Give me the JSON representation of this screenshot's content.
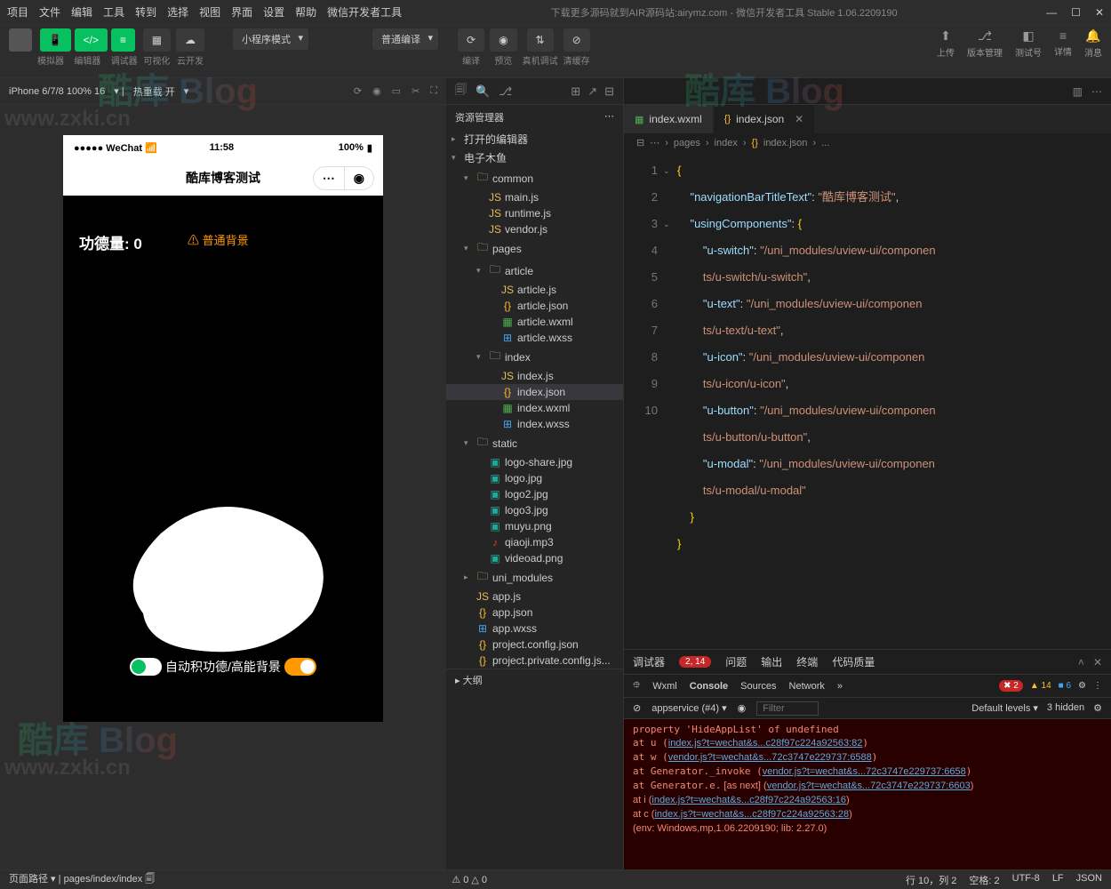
{
  "menubar": [
    "项目",
    "文件",
    "编辑",
    "工具",
    "转到",
    "选择",
    "视图",
    "界面",
    "设置",
    "帮助",
    "微信开发者工具"
  ],
  "window_title_suffix": "下载更多源码就到AIR源码站:airymz.com - 微信开发者工具 Stable 1.06.2209190",
  "toolbar": {
    "simulator": "模拟器",
    "editor": "编辑器",
    "debugger": "调试器",
    "visualize": "可视化",
    "cloud": "云开发",
    "mode_select": "小程序模式",
    "compile_select": "普通编译",
    "compile": "编译",
    "preview": "预览",
    "remote": "真机调试",
    "clearcache": "清缓存",
    "upload": "上传",
    "version": "版本管理",
    "testacct": "测试号",
    "details": "详情",
    "messages": "消息"
  },
  "simheader": {
    "device": "iPhone 6/7/8 100% 16",
    "hotreload": "热重载 开"
  },
  "phone": {
    "carrier": "WeChat",
    "time": "11:58",
    "battery": "100%",
    "nav_title": "酷库博客测试",
    "merit_label": "功德量:",
    "merit_value": "0",
    "bg_btn": "⚠ 普通背景",
    "switch_label": "自动积功德/高能背景"
  },
  "explorer": {
    "title": "资源管理器",
    "sections": {
      "open_editors": "打开的编辑器",
      "project": "电子木鱼",
      "outline": "大纲"
    },
    "tree": {
      "common": {
        "name": "common",
        "files": [
          "main.js",
          "runtime.js",
          "vendor.js"
        ]
      },
      "pages": {
        "name": "pages",
        "article": {
          "name": "article",
          "files": [
            "article.js",
            "article.json",
            "article.wxml",
            "article.wxss"
          ]
        },
        "index": {
          "name": "index",
          "files": [
            "index.js",
            "index.json",
            "index.wxml",
            "index.wxss"
          ]
        }
      },
      "static": {
        "name": "static",
        "files": [
          "logo-share.jpg",
          "logo.jpg",
          "logo2.jpg",
          "logo3.jpg",
          "muyu.png",
          "qiaoji.mp3",
          "videoad.png"
        ]
      },
      "uni_modules": "uni_modules",
      "root_files": [
        "app.js",
        "app.json",
        "app.wxss",
        "project.config.json",
        "project.private.config.js..."
      ]
    }
  },
  "editor": {
    "tab1": "index.wxml",
    "tab2": "index.json",
    "breadcrumb": [
      "pages",
      "index",
      "index.json",
      "..."
    ],
    "json": {
      "navigationBarTitleText": "酷库博客测试",
      "usingComponents_key": "usingComponents",
      "components": {
        "u-switch": "/uni_modules/uview-ui/components/u-switch/u-switch",
        "u-text": "/uni_modules/uview-ui/components/u-text/u-text",
        "u-icon": "/uni_modules/uview-ui/components/u-icon/u-icon",
        "u-button": "/uni_modules/uview-ui/components/u-button/u-button",
        "u-modal": "/uni_modules/uview-ui/components/u-modal/u-modal"
      }
    },
    "line_numbers": [
      "1",
      "2",
      "3",
      "4",
      "5",
      "6",
      "7",
      "8",
      "9",
      "10"
    ]
  },
  "console": {
    "tabs": {
      "debugger": "调试器",
      "badge": "2, 14",
      "problems": "问题",
      "output": "输出",
      "terminal": "终端",
      "quality": "代码质量"
    },
    "devtabs": [
      "Wxml",
      "Console",
      "Sources",
      "Network"
    ],
    "badges": {
      "errors": "2",
      "warnings": "14",
      "info": "6"
    },
    "filter_context": "appservice (#4)",
    "filter_placeholder": "Filter",
    "levels": "Default levels",
    "hidden": "3 hidden",
    "lines": [
      "property 'HideAppList' of undefined",
      "    at u (index.js?t=wechat&s...c28f97c224a92563:82)",
      "    at w (vendor.js?t=wechat&s...72c3747e229737:6588)",
      "    at Generator._invoke (vendor.js?t=wechat&s...72c3747e229737:6658)",
      "    at Generator.e.<computed> [as next] (vendor.js?t=wechat&s...72c3747e229737:6603)",
      "    at i (index.js?t=wechat&s...c28f97c224a92563:16)",
      "    at c (index.js?t=wechat&s...c28f97c224a92563:28)",
      "(env: Windows,mp,1.06.2209190; lib: 2.27.0)"
    ]
  },
  "statusbar": {
    "path_label": "页面路径",
    "path": "pages/index/index",
    "warnings": "⚠ 0 △ 0",
    "pos": "行 10，列 2",
    "spaces": "空格: 2",
    "encoding": "UTF-8",
    "eol": "LF",
    "lang": "JSON"
  }
}
